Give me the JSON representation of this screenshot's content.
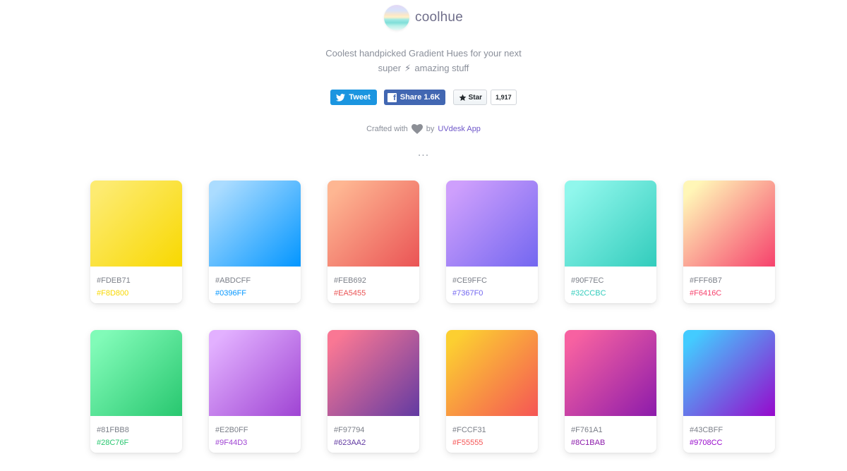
{
  "brand": {
    "name": "coolhue"
  },
  "tagline": {
    "line1": "Coolest handpicked Gradient Hues for your next",
    "line2_before": "super",
    "line2_icon": "⚡",
    "line2_after": "amazing stuff"
  },
  "social": {
    "tweet_label": "Tweet",
    "share_label": "Share 1.6K",
    "star_label": "Star",
    "star_count": "1,917"
  },
  "credit": {
    "prefix": "Crafted with",
    "by": "by",
    "link": "UVdesk App"
  },
  "divider": "...",
  "gradients": [
    {
      "start": "#FDEB71",
      "end": "#F8D800"
    },
    {
      "start": "#ABDCFF",
      "end": "#0396FF"
    },
    {
      "start": "#FEB692",
      "end": "#EA5455"
    },
    {
      "start": "#CE9FFC",
      "end": "#7367F0"
    },
    {
      "start": "#90F7EC",
      "end": "#32CCBC"
    },
    {
      "start": "#FFF6B7",
      "end": "#F6416C"
    },
    {
      "start": "#81FBB8",
      "end": "#28C76F"
    },
    {
      "start": "#E2B0FF",
      "end": "#9F44D3"
    },
    {
      "start": "#F97794",
      "end": "#623AA2"
    },
    {
      "start": "#FCCF31",
      "end": "#F55555"
    },
    {
      "start": "#F761A1",
      "end": "#8C1BAB"
    },
    {
      "start": "#43CBFF",
      "end": "#9708CC"
    }
  ]
}
